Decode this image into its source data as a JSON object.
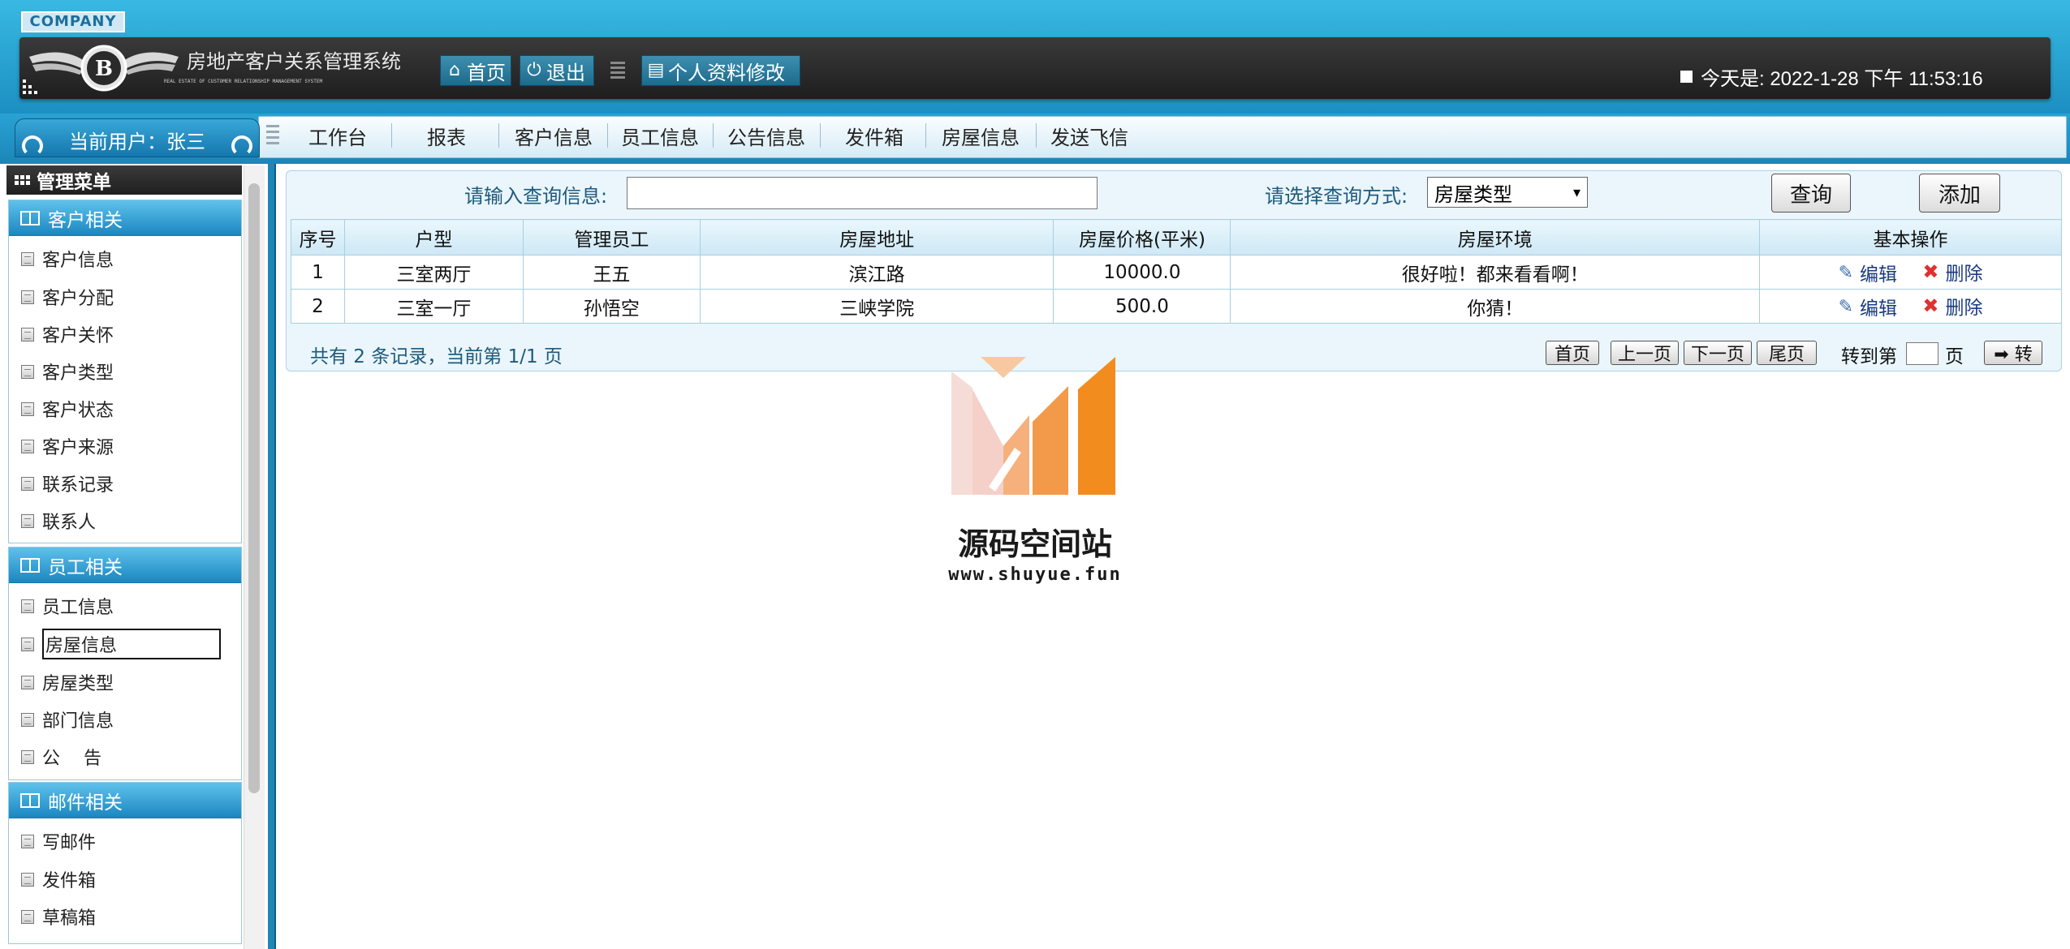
{
  "header": {
    "company": "COMPANY",
    "system_title": "房地产客户关系管理系统",
    "system_subtitle": "REAL ESTATE OF CUSTOMER RELATIONSHIP MANAGEMENT SYSTEM",
    "home_label": "首页",
    "logout_label": "退出",
    "profile_label": "个人资料修改",
    "date_text": "今天是:  2022-1-28 下午 11:53:16"
  },
  "user": {
    "label": "当前用户：张三"
  },
  "nav": {
    "items": [
      "工作台",
      "报表",
      "客户信息",
      "员工信息",
      "公告信息",
      "发件箱",
      "房屋信息",
      "发送飞信"
    ]
  },
  "sidebar": {
    "title": "管理菜单",
    "sections": [
      {
        "title": "客户相关",
        "items": [
          "客户信息",
          "客户分配",
          "客户关怀",
          "客户类型",
          "客户状态",
          "客户来源",
          "联系记录",
          "联系人"
        ]
      },
      {
        "title": "员工相关",
        "items": [
          "员工信息",
          "房屋信息",
          "房屋类型",
          "部门信息",
          "公　 告"
        ]
      },
      {
        "title": "邮件相关",
        "items": [
          "写邮件",
          "发件箱",
          "草稿箱"
        ]
      }
    ],
    "selected": "房屋信息"
  },
  "search": {
    "label": "请输入查询信息:",
    "value": "",
    "mode_label": "请选择查询方式:",
    "mode_value": "房屋类型",
    "query_button": "查询",
    "add_button": "添加"
  },
  "table": {
    "columns": [
      "序号",
      "户型",
      "管理员工",
      "房屋地址",
      "房屋价格(平米)",
      "房屋环境",
      "基本操作"
    ],
    "rows": [
      [
        "1",
        "三室两厅",
        "王五",
        "滨江路",
        "10000.0",
        "很好啦！都来看看啊！"
      ],
      [
        "2",
        "三室一厅",
        "孙悟空",
        "三峡学院",
        "500.0",
        "你猜！"
      ]
    ],
    "edit_label": "编辑",
    "delete_label": "删除"
  },
  "pagination": {
    "summary": "共有 2 条记录，当前第 1/1 页",
    "first": "首页",
    "prev": "上一页",
    "next": "下一页",
    "last": "尾页",
    "goto_label": "转到第",
    "page_unit": "页",
    "go_button": "➡ 转"
  },
  "watermark": {
    "title": "源码空间站",
    "url": "www.shuyue.fun"
  },
  "colors": {
    "header_blue": "#1c8fc2",
    "dark_bar": "#1e1e1e",
    "accent_orange": "#f28c1e"
  }
}
